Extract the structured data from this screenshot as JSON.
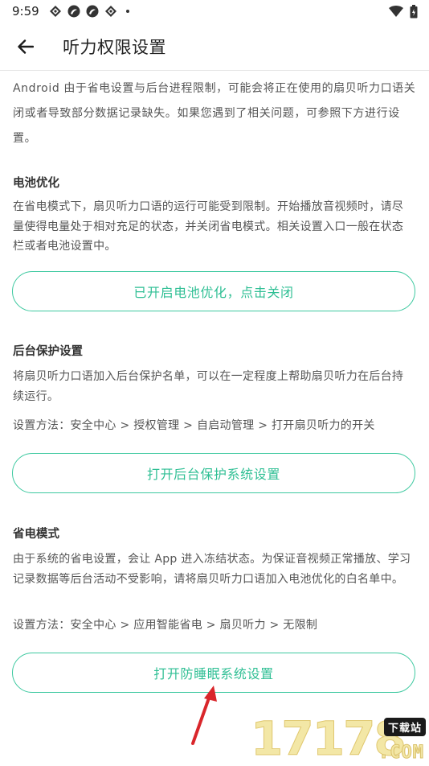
{
  "status_bar": {
    "time": "9:59",
    "icons": [
      "notification-icon-1",
      "notification-icon-2",
      "notification-icon-3",
      "notification-icon-4",
      "wifi-icon",
      "battery-icon"
    ]
  },
  "app_bar": {
    "title": "听力权限设置",
    "back_icon": "arrow-left-icon"
  },
  "intro": "Android 由于省电设置与后台进程限制，可能会将正在使用的扇贝听力口语关闭或者导致部分数据记录缺失。如果您遇到了相关问题，可参照下方进行设置。",
  "sections": [
    {
      "title": "电池优化",
      "description": "在省电模式下，扇贝听力口语的运行可能受到限制。开始播放音视频时，请尽量使得电量处于相对充足的状态，并关闭省电模式。相关设置入口一般在状态栏或者电池设置中。",
      "method": "",
      "button": "已开启电池优化，点击关闭"
    },
    {
      "title": "后台保护设置",
      "description": "将扇贝听力口语加入后台保护名单，可以在一定程度上帮助扇贝听力在后台持续运行。",
      "method": "设置方法：安全中心 > 授权管理 > 自启动管理 > 打开扇贝听力的开关",
      "button": "打开后台保护系统设置"
    },
    {
      "title": "省电模式",
      "description": "由于系统的省电设置，会让 App 进入冻结状态。为保证音视频正常播放、学习记录数据等后台活动不受影响，请将扇贝听力口语加入电池优化的白名单中。",
      "method": "设置方法：安全中心 > 应用智能省电 > 扇贝听力 > 无限制",
      "button": "打开防睡眠系统设置"
    }
  ],
  "watermark": {
    "number": "17178",
    "badge": "下载站",
    "suffix": ".COM"
  },
  "colors": {
    "accent": "#3ec9a0",
    "accent_text": "#2fbf94",
    "arrow": "#d9262b"
  }
}
